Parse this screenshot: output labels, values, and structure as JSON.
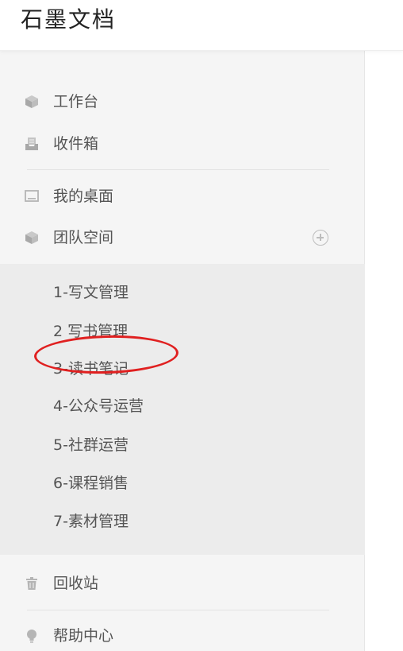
{
  "header": {
    "title": "石墨文档"
  },
  "nav": {
    "workspace": "工作台",
    "inbox": "收件箱",
    "desktop": "我的桌面",
    "team": "团队空间",
    "trash": "回收站",
    "help": "帮助中心"
  },
  "team_items": [
    "1-写文管理",
    "2 写书管理",
    "3-读书笔记",
    "4-公众号运营",
    "5-社群运营",
    "6-课程销售",
    "7-素材管理"
  ],
  "icons": {
    "workspace": "cube-icon",
    "inbox": "inbox-icon",
    "desktop": "monitor-icon",
    "team": "cube-icon",
    "add": "plus-circle-icon",
    "trash": "trash-icon",
    "help": "lightbulb-icon"
  },
  "colors": {
    "annotation": "#e02020",
    "sidebar_bg": "#f5f5f5",
    "team_bg": "#ececec",
    "text": "#555555"
  }
}
